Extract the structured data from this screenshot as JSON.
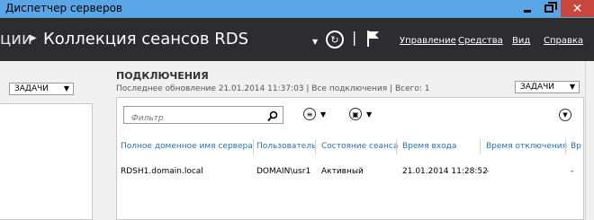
{
  "window": {
    "title": "Диспетчер серверов"
  },
  "header": {
    "breadcrumb_prev": "ции",
    "breadcrumb_current": "Коллекция сеансов RDS",
    "menu": {
      "manage": "Управление",
      "tools": "Средства",
      "view": "Вид",
      "help": "Справка"
    }
  },
  "left": {
    "tasks_label": "ЗАДАЧИ"
  },
  "connections": {
    "title": "ПОДКЛЮЧЕНИЯ",
    "subtitle": "Последнее обновление 21.01.2014 11:37:03 | Все подключения  | Всего: 1",
    "tasks_label": "ЗАДАЧИ",
    "filter_placeholder": "Фильтр",
    "columns": [
      "Полное доменное имя сервера",
      "Пользователь",
      "Состояние сеанса",
      "Время входа",
      "Время отключения",
      "Вр"
    ],
    "rows": [
      [
        "RDSH1.domain.local",
        "DOMAIN\\usr1",
        "Активный",
        "21.01.2014 11:28:52",
        "-",
        "-"
      ]
    ]
  },
  "colors": {
    "titlebar": "#5aa5e6",
    "header": "#2d2d30",
    "close": "#c9463d",
    "link": "#2a6fb5"
  },
  "icons": [
    "refresh-icon",
    "flag-icon",
    "search-icon",
    "list-options-icon",
    "save-options-icon",
    "expand-icon"
  ]
}
